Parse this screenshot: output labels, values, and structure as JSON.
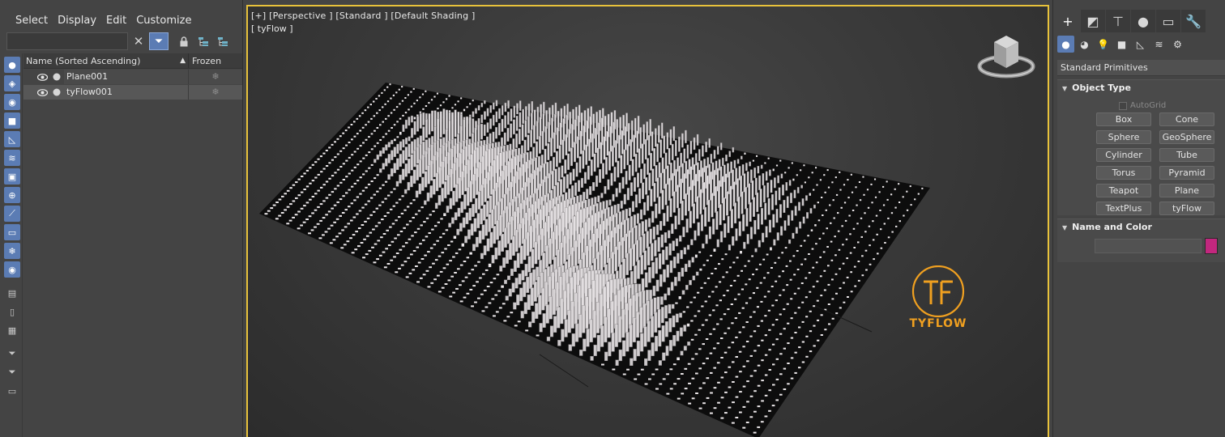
{
  "explorer": {
    "menu": [
      "Select",
      "Display",
      "Edit",
      "Customize"
    ],
    "search_value": "",
    "columns": {
      "name": "Name (Sorted Ascending)",
      "sort_glyph": "▲",
      "frozen": "Frozen"
    },
    "rows": [
      {
        "name": "Plane001",
        "frozen_glyph": "❄"
      },
      {
        "name": "tyFlow001",
        "frozen_glyph": "❄"
      }
    ],
    "toolbar_glyphs": {
      "close": "✕",
      "filter": "⏷",
      "lock": "🔒",
      "h1": "⊞",
      "h2": "⊟"
    },
    "strip_icons": [
      "sphere-icon",
      "shapes-icon",
      "light-icon",
      "camera-icon",
      "helper-icon",
      "spacewarp-icon",
      "group-icon",
      "xref-icon",
      "bone-icon",
      "container-icon",
      "frozen-icon",
      "eye-icon",
      "layer-list-icon",
      "blank-icon",
      "page-icon",
      "filter-lock-icon",
      "filter-icon",
      "container-box-icon"
    ]
  },
  "viewport": {
    "label": "[+] [Perspective ] [Standard ] [Default Shading ]",
    "sublabel": "[ tyFlow ]",
    "watermark": "TYFLOW",
    "watermark_color": "#f0a020",
    "frame_color": "#e8c23b"
  },
  "command_panel": {
    "tab_icons": [
      "create-icon",
      "modify-icon",
      "hierarchy-icon",
      "motion-icon",
      "display-icon",
      "utilities-icon"
    ],
    "tab_glyphs": [
      "+",
      "◩",
      "⊤",
      "●",
      "▭",
      "🔧"
    ],
    "category_icons": [
      "geometry-icon",
      "shapes-icon",
      "lights-icon",
      "cameras-icon",
      "helpers-icon",
      "spacewarps-icon",
      "systems-icon"
    ],
    "category_glyphs": [
      "●",
      "◕",
      "💡",
      "■",
      "◺",
      "≋",
      "⚙"
    ],
    "dropdown": "Standard Primitives",
    "object_type": {
      "title": "Object Type",
      "autogrid": "AutoGrid",
      "buttons": [
        "Box",
        "Cone",
        "Sphere",
        "GeoSphere",
        "Cylinder",
        "Tube",
        "Torus",
        "Pyramid",
        "Teapot",
        "Plane",
        "TextPlus",
        "tyFlow"
      ]
    },
    "name_color": {
      "title": "Name and Color",
      "name_value": "",
      "swatch_color": "#c2277e"
    }
  }
}
